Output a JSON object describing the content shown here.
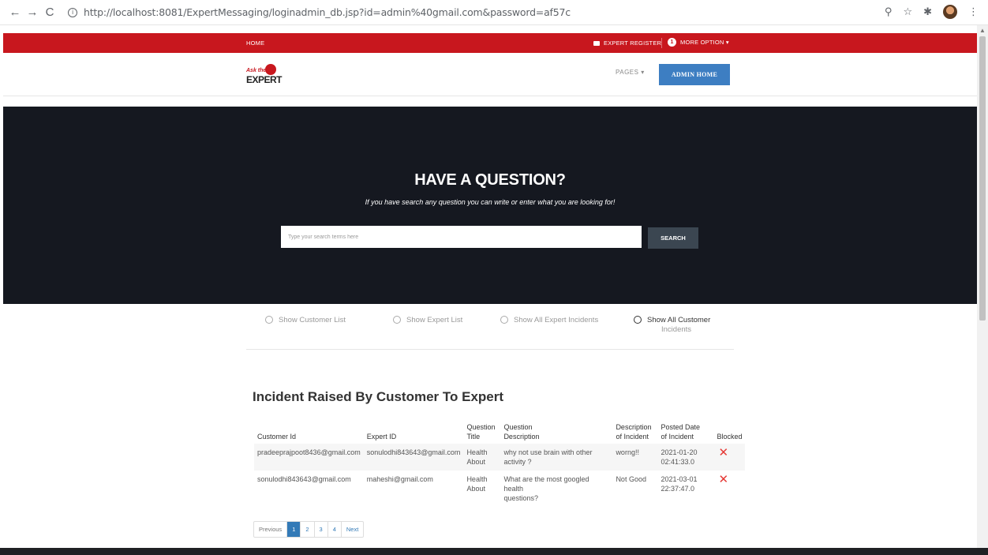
{
  "browser": {
    "url": "http://localhost:8081/ExpertMessaging/loginadmin_db.jsp?id=admin%40gmail.com&password=af57c"
  },
  "topbar": {
    "home": "HOME",
    "expert_register": "EXPERT REGISTER",
    "notification_count": "1",
    "more_option": "MORE OPTION ▾"
  },
  "header": {
    "logo_ask": "Ask the",
    "logo_expert": "EXPERT",
    "pages": "PAGES ▾",
    "admin_home": "ADMIN HOME"
  },
  "hero": {
    "title": "HAVE A QUESTION?",
    "subtitle": "If you have search any question you can write or enter what you are looking for!",
    "search_placeholder": "Type your search terms here",
    "search_button": "SEARCH"
  },
  "tabs": [
    {
      "label": "Show Customer List"
    },
    {
      "label": "Show Expert List"
    },
    {
      "label": "Show All Expert Incidents"
    },
    {
      "label_line1": "Show All Customer",
      "label_line2": "Incidents"
    }
  ],
  "table": {
    "title": "Incident Raised By Customer To Expert",
    "headers": {
      "customer_id": "Customer Id",
      "expert_id": "Expert ID",
      "question_title_1": "Question",
      "question_title_2": "Title",
      "question_desc_1": "Question",
      "question_desc_2": "Description",
      "incident_desc_1": "Description",
      "incident_desc_2": "of Incident",
      "posted_1": "Posted Date",
      "posted_2": "of Incident",
      "blocked": "Blocked"
    },
    "rows": [
      {
        "customer_id": "pradeeprajpoot8436@gmail.com",
        "expert_id": "sonulodhi843643@gmail.com",
        "title_1": "Health",
        "title_2": "About",
        "question_1": "why not use brain with other",
        "question_2": "activity ?",
        "description": "worng!!",
        "posted_1": "2021-01-20",
        "posted_2": "02:41:33.0",
        "blocked_icon": "close-icon"
      },
      {
        "customer_id": "sonulodhi843643@gmail.com",
        "expert_id": "maheshi@gmail.com",
        "title_1": "Health",
        "title_2": "About",
        "question_1": "What are the most googled health",
        "question_2": "questions?",
        "description": "Not Good",
        "posted_1": "2021-03-01",
        "posted_2": "22:37:47.0",
        "blocked_icon": "close-icon"
      }
    ]
  },
  "pagination": {
    "previous": "Previous",
    "pages": [
      "1",
      "2",
      "3",
      "4"
    ],
    "next": "Next",
    "active": "1"
  },
  "colors": {
    "topbar_red": "#c8171e",
    "hero_dark": "#151820",
    "admin_button_blue": "#3d7ec2",
    "blocked_red": "#e53935"
  }
}
